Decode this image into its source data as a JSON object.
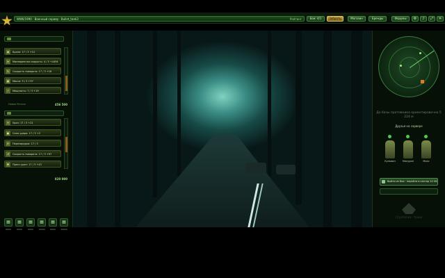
{
  "header": {
    "title": "WWII/1990 · Военный сервер · Bullet_tank3",
    "title_right": "Рейтинг",
    "buttons": [
      {
        "label": "Бои: 4/1"
      },
      {
        "label": "Забрать"
      },
      {
        "label": "Магазин"
      },
      {
        "label": "Бренды"
      },
      {
        "label": "Форумы"
      }
    ]
  },
  "left": {
    "upgrades": [
      {
        "label": "Броня: 17 / 3 +14"
      },
      {
        "label": "Маневренная скорость: 4 / 5 +4494"
      },
      {
        "label": "Скорость поворота: 17 / 3 +16"
      },
      {
        "label": "Масса: 9 / 3 +97"
      },
      {
        "label": "Мощность: 7 / 3 +19"
      }
    ],
    "upgrades_total": "456 500",
    "section_label": "Новая Регион",
    "weapons": [
      {
        "label": "Урон: 17 / 3 +21"
      },
      {
        "label": "Сила удара: 17 / 3 +3"
      },
      {
        "label": "Перезарядка: 17 / 3"
      },
      {
        "label": "Скорость поворота: 17 / 3 +97"
      },
      {
        "label": "Пресс-урон: 17 / 3 +43"
      }
    ],
    "weapons_total": "820 000",
    "bottom_buttons": [
      {
        "label": "8000"
      },
      {
        "label": "8000"
      },
      {
        "label": "8000"
      },
      {
        "label": "10000"
      },
      {
        "label": "8000"
      },
      {
        "label": "30000"
      }
    ]
  },
  "right": {
    "distance_text": "До базы противника ориентировочно 5 224 м",
    "friends_title": "Друзья на сервере",
    "friends": [
      {
        "name": "Кульвин"
      },
      {
        "name": "Макурин"
      },
      {
        "name": "Микс"
      }
    ],
    "sector_button": "Выйти из боя · перейти в сектор 10 000",
    "brand": "Стратегия · танки"
  }
}
